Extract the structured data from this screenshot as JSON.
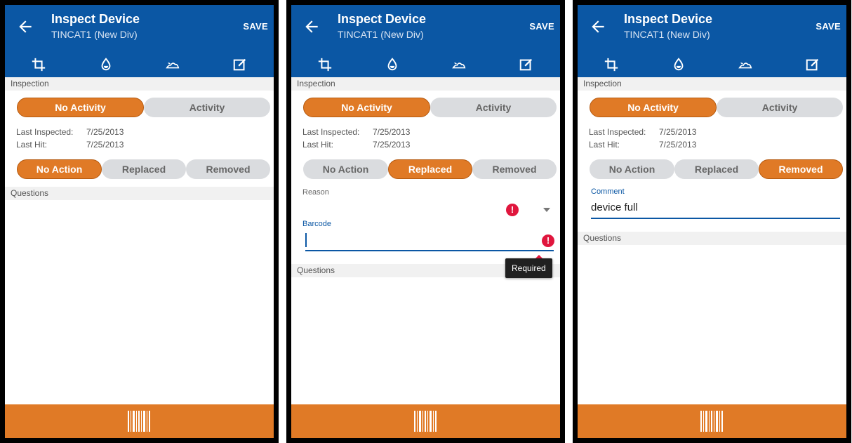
{
  "colors": {
    "appbar": "#0b57a4",
    "accent": "#e07a26",
    "segment_inactive": "#dadcdf",
    "error": "#e0163d"
  },
  "screens": [
    {
      "header": {
        "title": "Inspect Device",
        "subtitle": "TINCAT1 (New Div)",
        "save_label": "SAVE"
      },
      "tabs": [
        {
          "icon": "crop-icon",
          "active": true
        },
        {
          "icon": "water-drop-icon",
          "active": false
        },
        {
          "icon": "terrain-icon",
          "active": false
        },
        {
          "icon": "edit-note-icon",
          "active": false
        }
      ],
      "inspection_header": "Inspection",
      "activity": [
        "No Activity",
        "Activity"
      ],
      "activity_selected": "No Activity",
      "last_inspected_label": "Last Inspected:",
      "last_inspected_value": "7/25/2013",
      "last_hit_label": "Last Hit:",
      "last_hit_value": "7/25/2013",
      "action": [
        "No Action",
        "Replaced",
        "Removed"
      ],
      "action_selected": "No Action",
      "questions_header": "Questions",
      "bottom_icon": "barcode-icon"
    },
    {
      "header": {
        "title": "Inspect Device",
        "subtitle": "TINCAT1 (New Div)",
        "save_label": "SAVE"
      },
      "tabs": [
        {
          "icon": "crop-icon",
          "active": true
        },
        {
          "icon": "water-drop-icon",
          "active": false
        },
        {
          "icon": "terrain-icon",
          "active": false
        },
        {
          "icon": "edit-note-icon",
          "active": false
        }
      ],
      "inspection_header": "Inspection",
      "activity": [
        "No Activity",
        "Activity"
      ],
      "activity_selected": "No Activity",
      "last_inspected_label": "Last Inspected:",
      "last_inspected_value": "7/25/2013",
      "last_hit_label": "Last Hit:",
      "last_hit_value": "7/25/2013",
      "action": [
        "No Action",
        "Replaced",
        "Removed"
      ],
      "action_selected": "Replaced",
      "reason_label": "Reason",
      "reason_value": "",
      "barcode_label": "Barcode",
      "barcode_value": "",
      "required_tooltip": "Required",
      "questions_header": "Questions",
      "bottom_icon": "barcode-icon"
    },
    {
      "header": {
        "title": "Inspect Device",
        "subtitle": "TINCAT1 (New Div)",
        "save_label": "SAVE"
      },
      "tabs": [
        {
          "icon": "crop-icon",
          "active": true
        },
        {
          "icon": "water-drop-icon",
          "active": false
        },
        {
          "icon": "terrain-icon",
          "active": false
        },
        {
          "icon": "edit-note-icon",
          "active": false
        }
      ],
      "inspection_header": "Inspection",
      "activity": [
        "No Activity",
        "Activity"
      ],
      "activity_selected": "No Activity",
      "last_inspected_label": "Last Inspected:",
      "last_inspected_value": "7/25/2013",
      "last_hit_label": "Last Hit:",
      "last_hit_value": "7/25/2013",
      "action": [
        "No Action",
        "Replaced",
        "Removed"
      ],
      "action_selected": "Removed",
      "comment_label": "Comment",
      "comment_value": "device full",
      "questions_header": "Questions",
      "bottom_icon": "barcode-icon"
    }
  ]
}
